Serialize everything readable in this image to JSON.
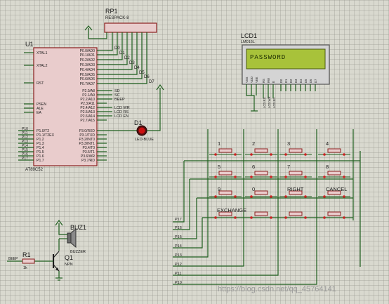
{
  "rp1": {
    "ref": "RP1",
    "part": "RESPACK-8"
  },
  "u1": {
    "ref": "U1",
    "part": "AT89C52",
    "left_pins": [
      "XTAL1",
      "XTAL2",
      "RST",
      "PSEN",
      "ALE",
      "EA",
      "P1.0/T2",
      "P1.1/T2EX",
      "P1.2",
      "P1.3",
      "P1.4",
      "P1.5",
      "P1.6",
      "P1.7"
    ],
    "right_pins": [
      "P0.0/AD0",
      "P0.1/AD1",
      "P0.2/AD2",
      "P0.3/AD3",
      "P0.4/AD4",
      "P0.5/AD5",
      "P0.6/AD6",
      "P0.7/AD7",
      "P2.0/A8",
      "P2.1/A9",
      "P2.2/A10",
      "P2.3/A11",
      "P2.4/A12",
      "P2.5/A13",
      "P2.6/A14",
      "P2.7/A15",
      "P3.0/RXD",
      "P3.1/TXD",
      "P3.2/INT0",
      "P3.3/INT1",
      "P3.4/T0",
      "P3.5/T1",
      "P3.6/WR",
      "P3.7/RD"
    ],
    "p0_nets": [
      "D0",
      "D1",
      "D2",
      "D3",
      "D4",
      "D5",
      "D6",
      "D7"
    ],
    "p2_nets": [
      "SD",
      "SC",
      "BEEP"
    ],
    "lcd_nets": [
      "LCD WR",
      "LCD RS",
      "LCD EN"
    ],
    "p1_nets": [
      "P10",
      "P11",
      "P12",
      "P13",
      "P14",
      "P15",
      "P16",
      "P17"
    ]
  },
  "lcd1": {
    "ref": "LCD1",
    "part": "LM016L",
    "display_text": "PASSWORD",
    "pins": [
      "VSS",
      "VDD",
      "VEE",
      "RS",
      "RW",
      "E",
      "D0",
      "D1",
      "D2",
      "D3",
      "D4",
      "D5",
      "D6",
      "D7"
    ],
    "nets": [
      "LCD RS",
      "LCD WR",
      "LCD EN"
    ]
  },
  "d1": {
    "ref": "D1",
    "part": "LED-BLUE"
  },
  "buz1": {
    "ref": "BUZ1",
    "part": "BUZZER"
  },
  "q1": {
    "ref": "Q1",
    "part": "NPN"
  },
  "r1": {
    "ref": "R1",
    "value": "1k",
    "net": "BEEP"
  },
  "keypad": {
    "row1": [
      "1",
      "2",
      "3",
      "4"
    ],
    "row2": [
      "5",
      "6",
      "7",
      "8"
    ],
    "row3": [
      "9",
      "0",
      "RIGHT",
      "CANCEL"
    ],
    "row4": [
      "EXCHANGE",
      "",
      "",
      ""
    ],
    "nets": [
      "P17",
      "P16",
      "P15",
      "P14",
      "P13",
      "P12",
      "P11",
      "P10"
    ]
  },
  "watermark": "https://blog.csdn.net/qq_45764141",
  "colors": {
    "wire": "#1f5f1f",
    "chip_fill": "#e9cccc",
    "chip_border": "#8b1e1e",
    "lcd_screen": "#a8c23a",
    "led": "#cc1111"
  }
}
